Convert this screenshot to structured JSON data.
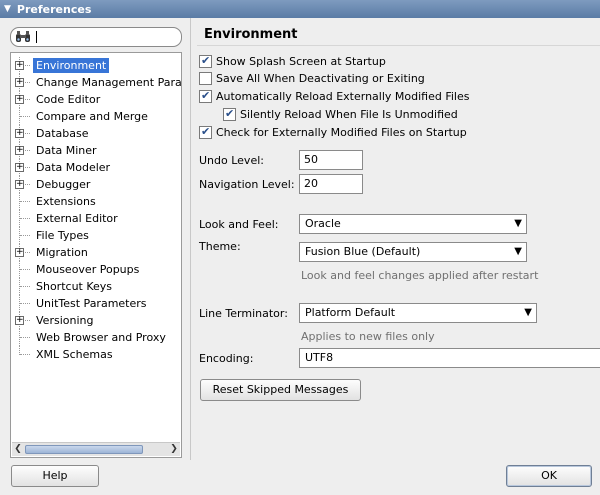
{
  "window": {
    "title": "Preferences"
  },
  "search": {
    "value": ""
  },
  "tree": {
    "items": [
      {
        "label": "Environment",
        "expandable": true,
        "selected": true
      },
      {
        "label": "Change Management Param",
        "expandable": true
      },
      {
        "label": "Code Editor",
        "expandable": true
      },
      {
        "label": "Compare and Merge",
        "expandable": false
      },
      {
        "label": "Database",
        "expandable": true
      },
      {
        "label": "Data Miner",
        "expandable": true
      },
      {
        "label": "Data Modeler",
        "expandable": true
      },
      {
        "label": "Debugger",
        "expandable": true
      },
      {
        "label": "Extensions",
        "expandable": false
      },
      {
        "label": "External Editor",
        "expandable": false
      },
      {
        "label": "File Types",
        "expandable": false
      },
      {
        "label": "Migration",
        "expandable": true
      },
      {
        "label": "Mouseover Popups",
        "expandable": false
      },
      {
        "label": "Shortcut Keys",
        "expandable": false
      },
      {
        "label": "UnitTest Parameters",
        "expandable": false
      },
      {
        "label": "Versioning",
        "expandable": true
      },
      {
        "label": "Web Browser and Proxy",
        "expandable": false
      },
      {
        "label": "XML Schemas",
        "expandable": false
      }
    ]
  },
  "page": {
    "title": "Environment"
  },
  "options": {
    "splash": {
      "label": "Show Splash Screen at Startup",
      "checked": true
    },
    "save_all": {
      "label": "Save All When Deactivating or Exiting",
      "checked": false
    },
    "auto_reload": {
      "label": "Automatically Reload Externally Modified Files",
      "checked": true
    },
    "silent_reload": {
      "label": "Silently Reload When File Is Unmodified",
      "checked": true
    },
    "check_modified": {
      "label": "Check for Externally Modified Files on Startup",
      "checked": true
    }
  },
  "undo": {
    "label": "Undo Level:",
    "value": "50"
  },
  "navigation": {
    "label": "Navigation Level:",
    "value": "20"
  },
  "look_and_feel": {
    "label": "Look and Feel:",
    "value": "Oracle"
  },
  "theme": {
    "label": "Theme:",
    "value": "Fusion Blue (Default)"
  },
  "look_hint": "Look and feel changes applied after restart",
  "line_terminator": {
    "label": "Line Terminator:",
    "value": "Platform Default"
  },
  "line_hint": "Applies to new files only",
  "encoding": {
    "label": "Encoding:",
    "value": "UTF8"
  },
  "buttons": {
    "reset": "Reset Skipped Messages",
    "help": "Help",
    "ok": "OK"
  },
  "colors": {
    "selection": "#3875d7",
    "titlebar": "#6a89b2"
  }
}
